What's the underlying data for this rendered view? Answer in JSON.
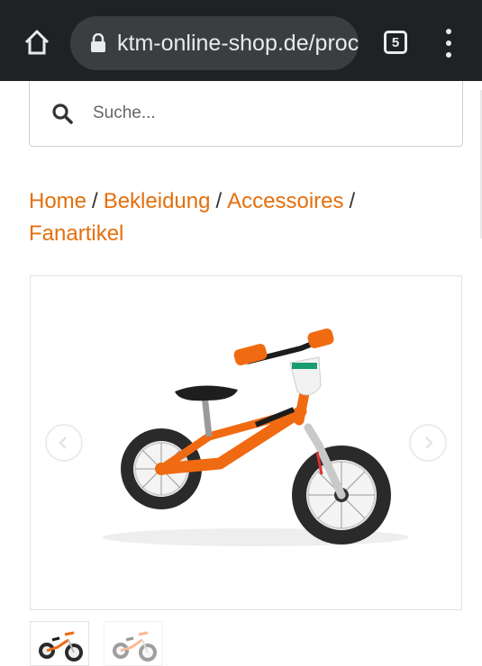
{
  "browser": {
    "url": "ktm-online-shop.de/proc",
    "tab_count": "5"
  },
  "search": {
    "placeholder": "Suche..."
  },
  "breadcrumb": {
    "items": [
      "Home",
      "Bekleidung",
      "Accessoires",
      "Fanartikel"
    ],
    "separator": "/"
  },
  "product": {
    "image_icon": "balance-bike",
    "thumbnails": [
      "balance-bike-orange",
      "balance-bike-faded"
    ]
  },
  "colors": {
    "accent": "#e46f0c",
    "chrome_bg": "#202124",
    "urlbar_bg": "#3c3d40"
  }
}
